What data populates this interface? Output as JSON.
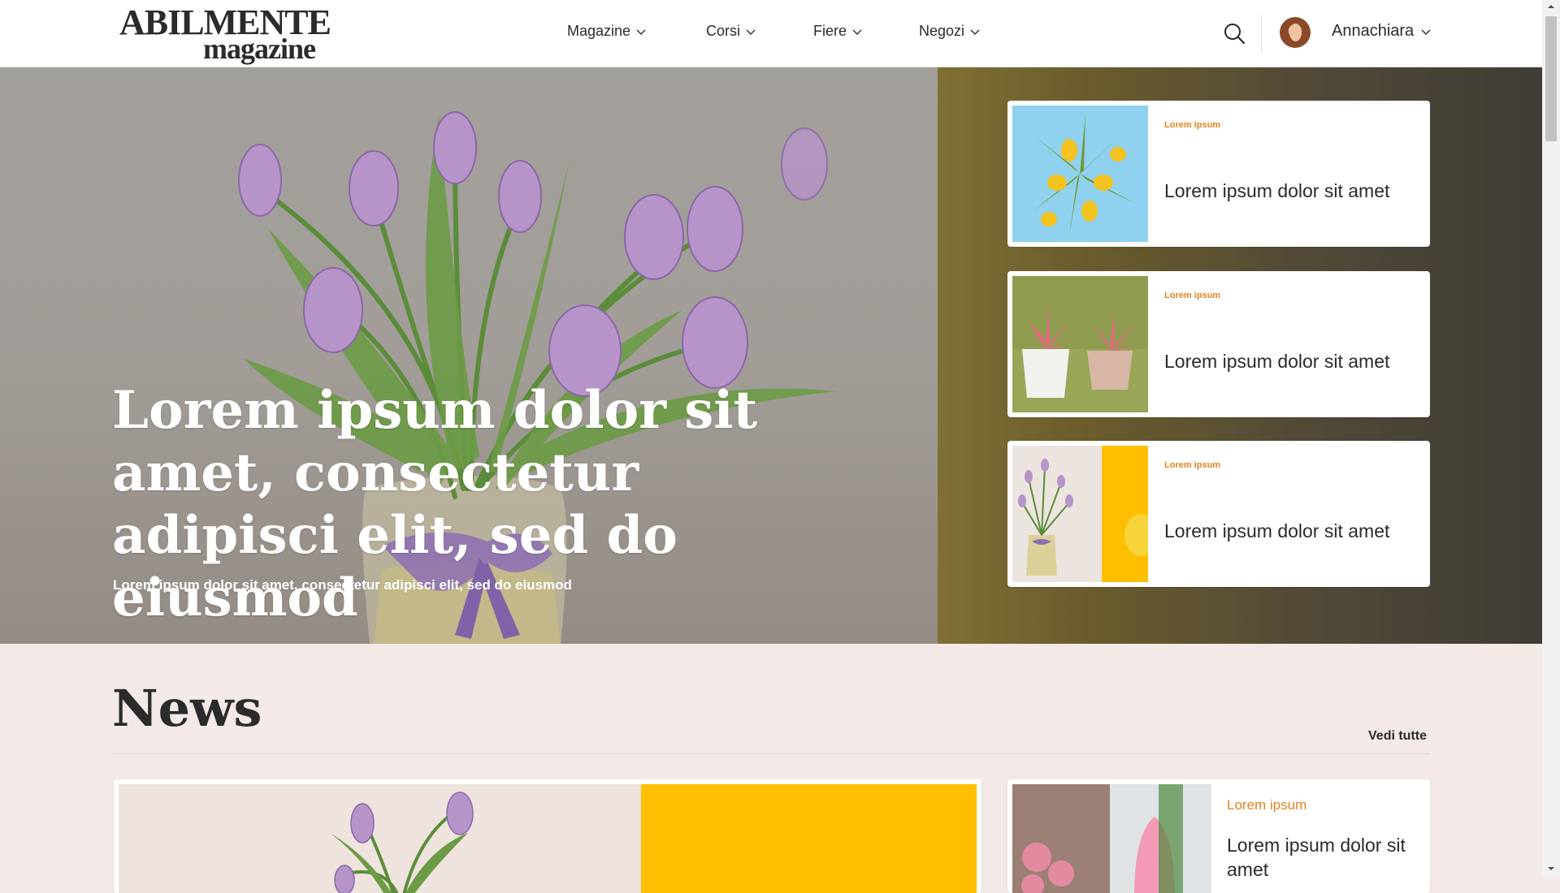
{
  "header": {
    "logo_top": "ABILMENTE",
    "logo_bottom": "magazine",
    "nav": [
      {
        "label": "Magazine"
      },
      {
        "label": "Corsi"
      },
      {
        "label": "Fiere"
      },
      {
        "label": "Negozi"
      }
    ],
    "user_name": "Annachiara",
    "icons": {
      "search": "search-icon",
      "chevron": "chevron-down-icon",
      "avatar": "user-avatar"
    }
  },
  "hero": {
    "title": "Lorem ipsum dolor sit amet, consectetur adipisci elit, sed do eiusmod",
    "subtitle": "Lorem ipsum dolor sit amet, consectetur adipisci elit, sed do eiusmod",
    "side_cards": [
      {
        "category": "Lorem ipsum",
        "title": "Lorem ipsum dolor sit amet"
      },
      {
        "category": "Lorem ipsum",
        "title": "Lorem ipsum dolor sit amet"
      },
      {
        "category": "Lorem ipsum",
        "title": "Lorem ipsum dolor sit amet"
      }
    ]
  },
  "news": {
    "heading": "News",
    "see_all": "Vedi tutte",
    "small_card": {
      "category": "Lorem ipsum",
      "title": "Lorem ipsum dolor sit amet"
    }
  },
  "colors": {
    "accent": "#e8821e",
    "text": "#2b2b2b",
    "section_bg": "#f3e9e7",
    "yellow": "#ffbf00"
  }
}
